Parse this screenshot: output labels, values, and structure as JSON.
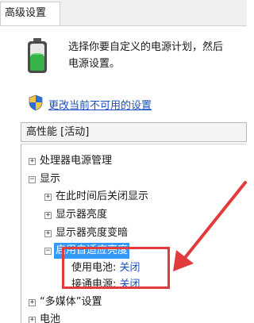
{
  "tab": {
    "label": "高级设置"
  },
  "intro": {
    "line1": "选择你要自定义的电源计划，然后",
    "line2": "电源设置。"
  },
  "change_link": "更改当前不可用的设置",
  "plan_select": {
    "value": "高性能 [活动]"
  },
  "tree": {
    "processor": {
      "toggle": "+",
      "label": "处理器电源管理"
    },
    "display": {
      "toggle": "−",
      "label": "显示"
    },
    "turn_off_after": {
      "toggle": "+",
      "label": "在此时间后关闭显示"
    },
    "brightness": {
      "toggle": "+",
      "label": "显示器亮度"
    },
    "dimmed_brightness": {
      "toggle": "+",
      "label": "显示器亮度变暗"
    },
    "adaptive": {
      "toggle": "−",
      "label": "启用自适应亮度"
    },
    "on_battery": {
      "label": "使用电池:",
      "value": "关闭"
    },
    "plugged_in": {
      "label": "接通电源:",
      "value": "关闭"
    },
    "multimedia": {
      "toggle": "+",
      "label": "“多媒体”设置"
    },
    "battery": {
      "toggle": "+",
      "label": "电池"
    }
  },
  "colors": {
    "link": "#1a4fbf",
    "highlight": "#3399ff",
    "annotation": "#e23b3b"
  }
}
